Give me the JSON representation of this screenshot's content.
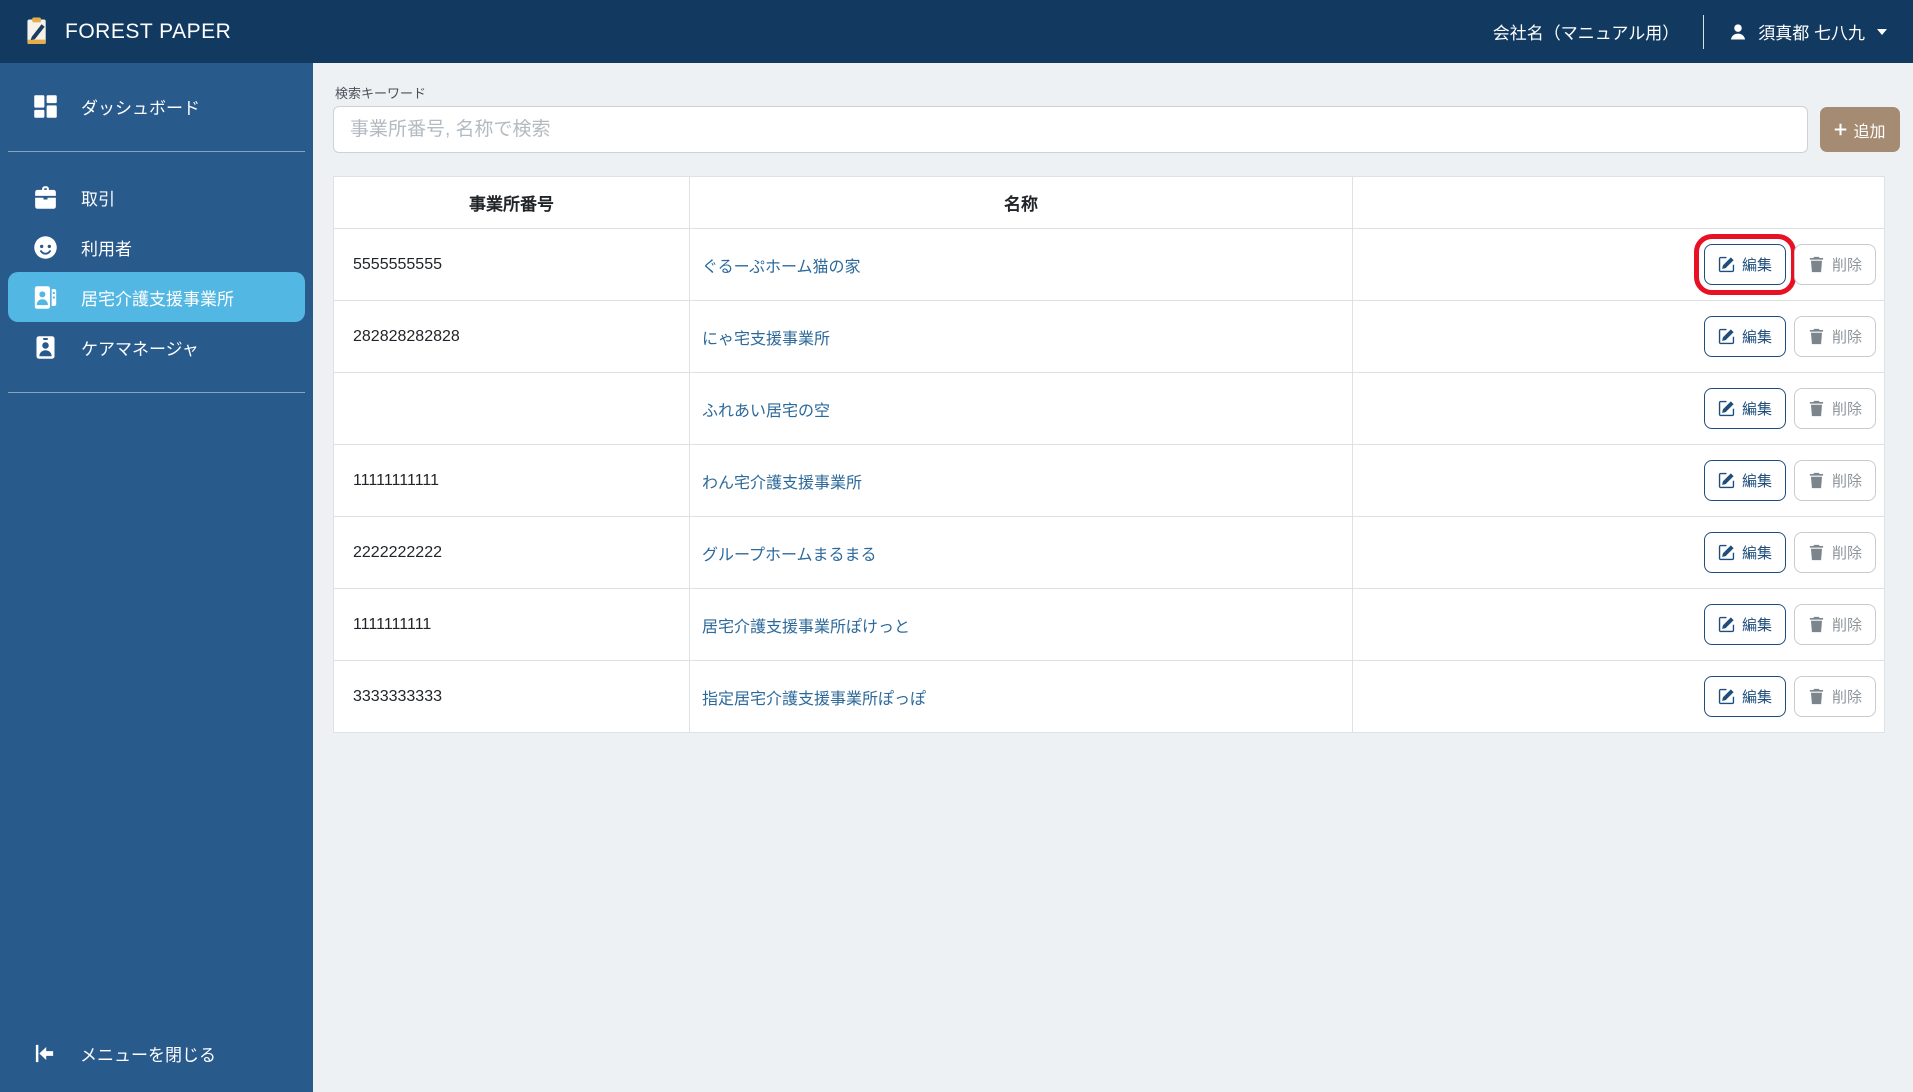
{
  "header": {
    "app_title": "FOREST PAPER",
    "logo_icon": "clipboard-pencil-icon",
    "company_name": "会社名（マニュアル用）",
    "user_icon": "person-icon",
    "user_name": "須真都 七八九",
    "caret_icon": "caret-down-icon"
  },
  "sidebar": {
    "items": [
      {
        "id": "dashboard",
        "label": "ダッシュボード",
        "icon": "dashboard-icon",
        "active": false
      },
      {
        "id": "transactions",
        "label": "取引",
        "icon": "briefcase-icon",
        "active": false
      },
      {
        "id": "users",
        "label": "利用者",
        "icon": "face-icon",
        "active": false
      },
      {
        "id": "care-offices",
        "label": "居宅介護支援事業所",
        "icon": "office-card-icon",
        "active": true
      },
      {
        "id": "care-managers",
        "label": "ケアマネージャ",
        "icon": "id-badge-icon",
        "active": false
      }
    ],
    "close_menu_label": "メニューを閉じる",
    "close_menu_icon": "collapse-left-icon"
  },
  "search": {
    "label": "検索キーワード",
    "placeholder": "事業所番号, 名称で検索",
    "add_button_label": "追加",
    "add_icon": "plus-icon"
  },
  "table": {
    "headers": [
      "事業所番号",
      "名称",
      ""
    ],
    "edit_label": "編集",
    "edit_icon": "pencil-square-icon",
    "delete_label": "削除",
    "delete_icon": "trash-icon",
    "rows": [
      {
        "office_number": "5555555555",
        "name": "ぐるーぷホーム猫の家",
        "highlighted": true
      },
      {
        "office_number": "282828282828",
        "name": "にゃ宅支援事業所",
        "highlighted": false
      },
      {
        "office_number": "",
        "name": "ふれあい居宅の空",
        "highlighted": false
      },
      {
        "office_number": "11111111111",
        "name": "わん宅介護支援事業所",
        "highlighted": false
      },
      {
        "office_number": "2222222222",
        "name": "グループホームまるまる",
        "highlighted": false
      },
      {
        "office_number": "1111111111",
        "name": "居宅介護支援事業所ぽけっと",
        "highlighted": false
      },
      {
        "office_number": "3333333333",
        "name": "指定居宅介護支援事業所ぽっぽ",
        "highlighted": false
      }
    ]
  },
  "annotation": {
    "highlighted_row_index": 0,
    "highlighted_button": "編集",
    "color": "#e81123"
  },
  "colors": {
    "header_bg": "#123a61",
    "sidebar_bg": "#285a8c",
    "active_item_bg": "#53b7e3",
    "content_bg": "#eef1f4",
    "add_button_bg": "#a68b73",
    "link_color": "#2d6a9b",
    "edit_button_color": "#1f4d7c",
    "delete_button_color": "#8e959b",
    "table_border": "#dee2e6"
  }
}
